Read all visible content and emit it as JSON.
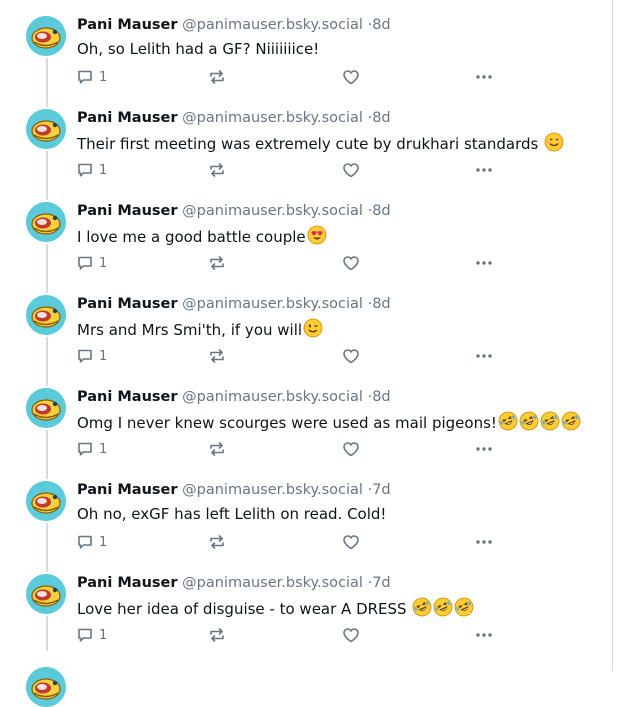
{
  "posts": [
    {
      "author": "Pani Mauser",
      "handle": "@panimauser.bsky.social",
      "time": "8d",
      "text": "Oh, so Lelith had a GF? Niiiiiiice!",
      "emojis": [],
      "replies": "1"
    },
    {
      "author": "Pani Mauser",
      "handle": "@panimauser.bsky.social",
      "time": "8d",
      "text": "Their first meeting was extremely cute by drukhari standards ",
      "emojis": [
        "smiling-face"
      ],
      "replies": "1"
    },
    {
      "author": "Pani Mauser",
      "handle": "@panimauser.bsky.social",
      "time": "8d",
      "text": "I love me a good battle couple",
      "emojis": [
        "heart-eyes"
      ],
      "replies": "1"
    },
    {
      "author": "Pani Mauser",
      "handle": "@panimauser.bsky.social",
      "time": "8d",
      "text": "Mrs and Mrs Smi'th, if you will",
      "emojis": [
        "winking-face"
      ],
      "replies": "1"
    },
    {
      "author": "Pani Mauser",
      "handle": "@panimauser.bsky.social",
      "time": "8d",
      "text": "Omg I never knew scourges were used as mail pigeons!",
      "emojis": [
        "rofl",
        "rofl",
        "rofl",
        "rofl"
      ],
      "replies": "1"
    },
    {
      "author": "Pani Mauser",
      "handle": "@panimauser.bsky.social",
      "time": "7d",
      "text": "Oh no, exGF has left Lelith on read. Cold!",
      "emojis": [],
      "replies": "1"
    },
    {
      "author": "Pani Mauser",
      "handle": "@panimauser.bsky.social",
      "time": "7d",
      "text": "Love her idea of disguise - to wear A DRESS ",
      "emojis": [
        "rofl",
        "rofl",
        "rofl"
      ],
      "replies": "1"
    }
  ],
  "colors": {
    "name": "#0f1419",
    "handle": "#687684",
    "icons": "#687684",
    "thread_line": "#d4dbe2",
    "avatar_bg": "#5bcadb"
  },
  "icons": {
    "reply": "speech-bubble-icon",
    "repost": "repost-arrows-icon",
    "like": "heart-outline-icon",
    "more": "ellipsis-icon"
  }
}
